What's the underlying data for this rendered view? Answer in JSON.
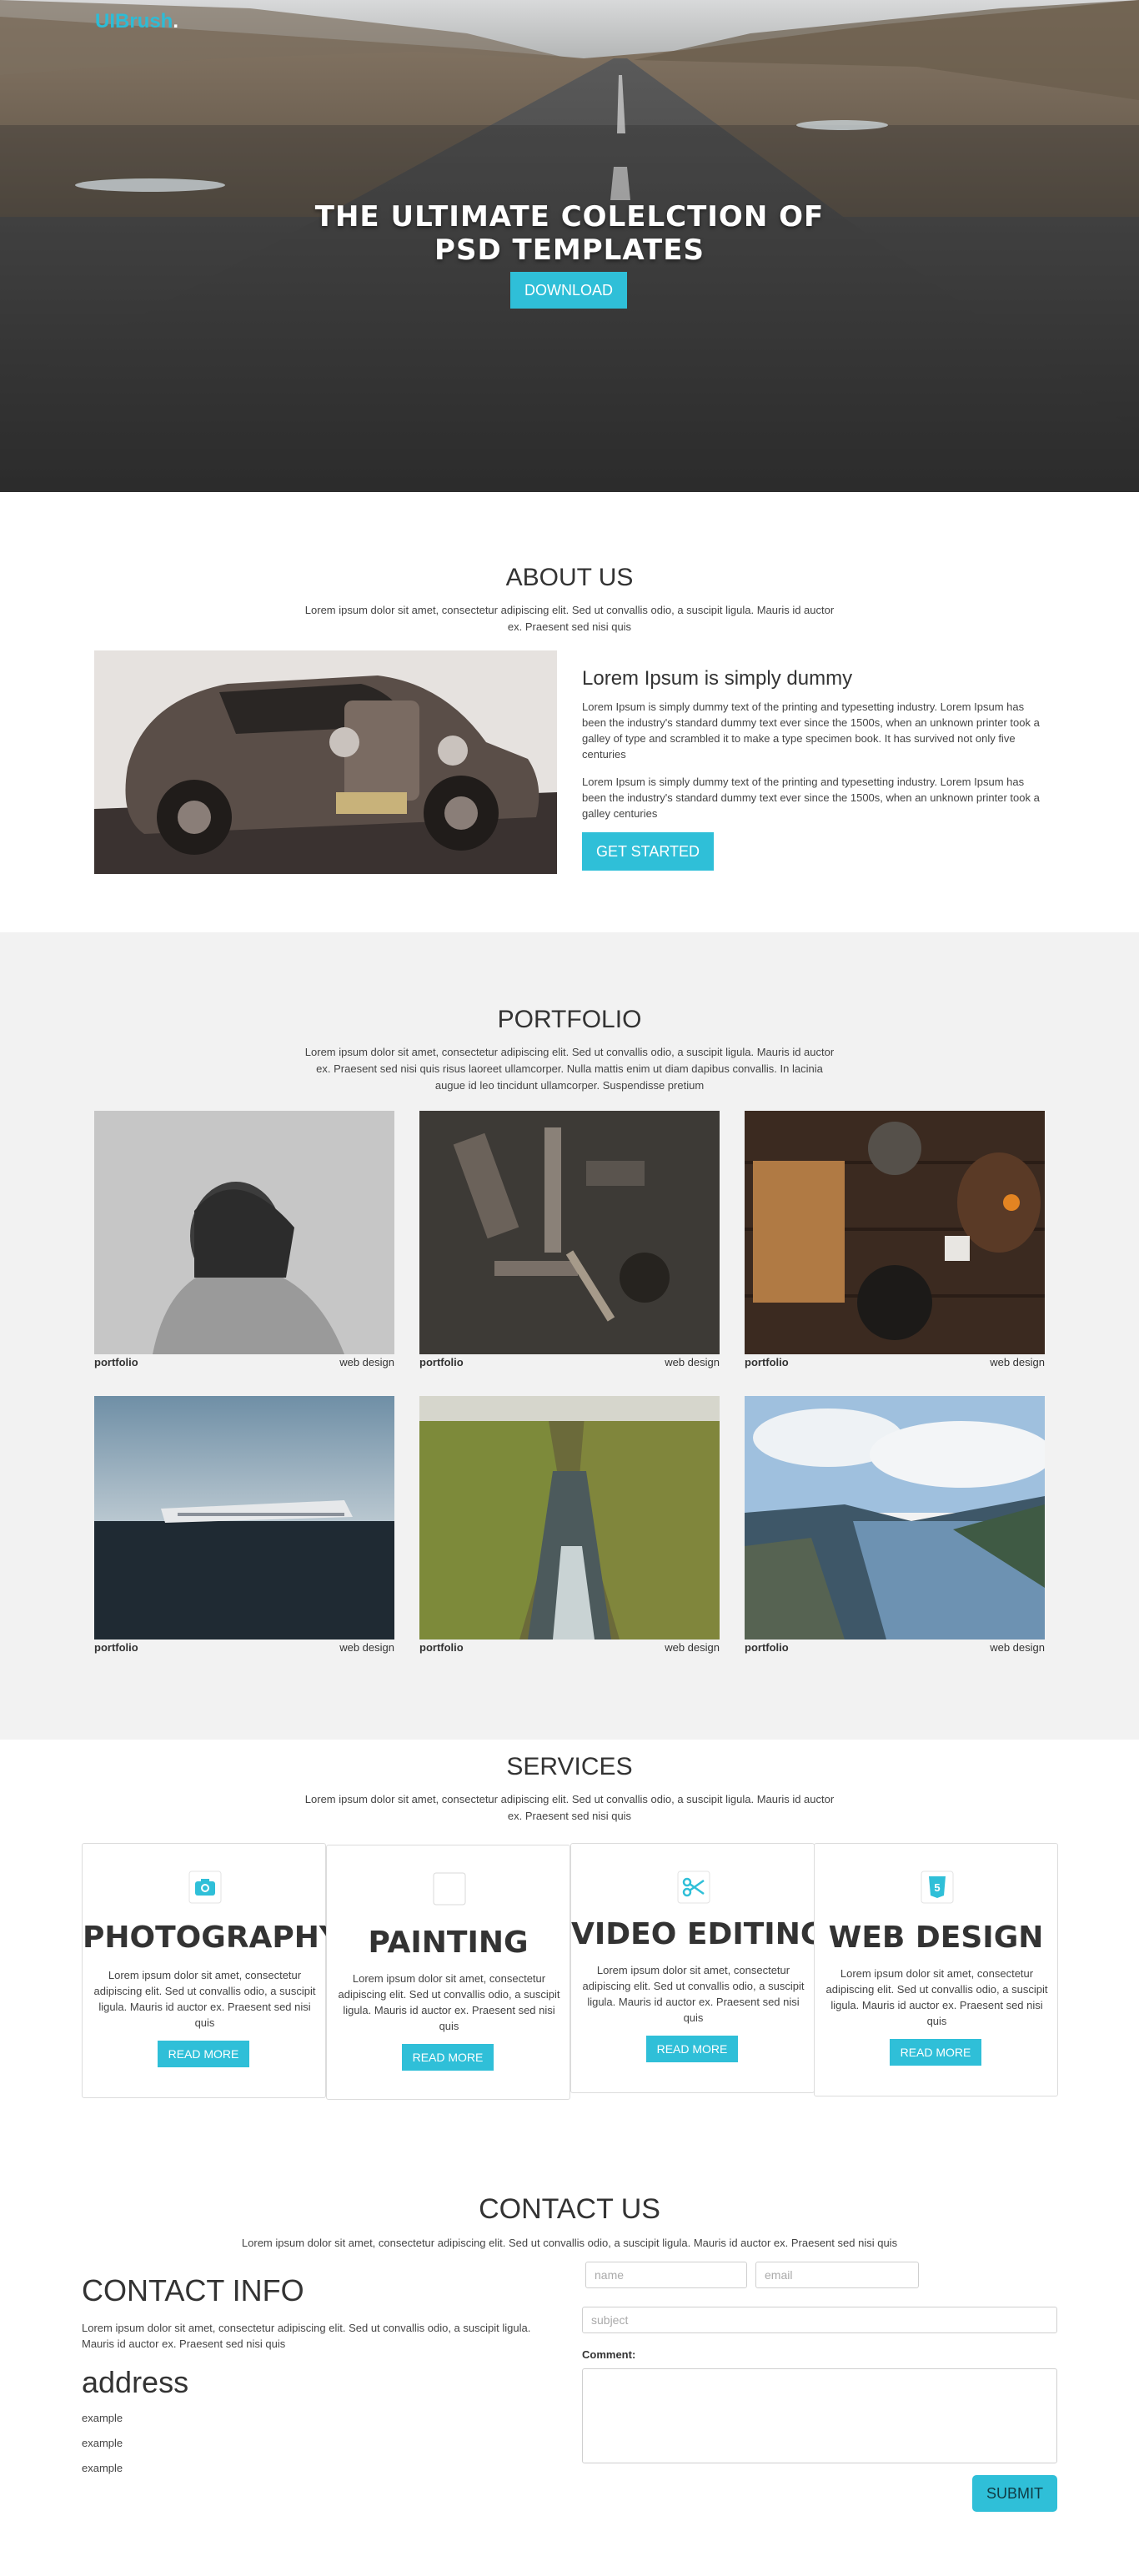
{
  "brand": {
    "logo_text": "UIBrush",
    "logo_dot": ".",
    "accent": "#2fbfd8"
  },
  "hero": {
    "title_line1": "THE ULTIMATE COLELCTION OF",
    "title_line2": "PSD TEMPLATES",
    "download_label": "DOWNLOAD"
  },
  "about": {
    "title": "ABOUT US",
    "subtitle": "Lorem ipsum dolor sit amet, consectetur adipiscing elit. Sed ut convallis odio, a suscipit ligula. Mauris id auctor ex. Praesent sed nisi quis",
    "heading": "Lorem Ipsum is simply dummy",
    "para1": "Lorem Ipsum is simply dummy text of the printing and typesetting industry. Lorem Ipsum has been the industry's standard dummy text ever since the 1500s, when an unknown printer took a galley of type and scrambled it to make a type specimen book. It has survived not only five centuries",
    "para2": "Lorem Ipsum is simply dummy text of the printing and typesetting industry. Lorem Ipsum has been the industry's standard dummy text ever since the 1500s, when an unknown printer took a galley centuries",
    "cta_label": "GET STARTED"
  },
  "portfolio": {
    "title": "PORTFOLIO",
    "subtitle": "Lorem ipsum dolor sit amet, consectetur adipiscing elit. Sed ut convallis odio, a suscipit ligula. Mauris id auctor ex. Praesent sed nisi quis risus laoreet ullamcorper. Nulla mattis enim ut diam dapibus convallis. In lacinia augue id leo tincidunt ullamcorper. Suspendisse pretium",
    "items": [
      {
        "label": "portfolio",
        "category": "web design"
      },
      {
        "label": "portfolio",
        "category": "web design"
      },
      {
        "label": "portfolio",
        "category": "web design"
      },
      {
        "label": "portfolio",
        "category": "web design"
      },
      {
        "label": "portfolio",
        "category": "web design"
      },
      {
        "label": "portfolio",
        "category": "web design"
      }
    ]
  },
  "services": {
    "title": "SERVICES",
    "subtitle": "Lorem ipsum dolor sit amet, consectetur adipiscing elit. Sed ut convallis odio, a suscipit ligula. Mauris id auctor ex. Praesent sed nisi quis",
    "items": [
      {
        "title": "PHOTOGRAPHY",
        "icon": "camera-icon",
        "text": "Lorem ipsum dolor sit amet, consectetur adipiscing elit. Sed ut convallis odio, a suscipit ligula. Mauris id auctor ex. Praesent sed nisi quis",
        "button": "READ MORE"
      },
      {
        "title": "PAINTING",
        "icon": "painting-icon",
        "text": "Lorem ipsum dolor sit amet, consectetur adipiscing elit. Sed ut convallis odio, a suscipit ligula. Mauris id auctor ex. Praesent sed nisi quis",
        "button": "READ MORE"
      },
      {
        "title": "VIDEO EDITING",
        "icon": "scissors-icon",
        "text": "Lorem ipsum dolor sit amet, consectetur adipiscing elit. Sed ut convallis odio, a suscipit ligula. Mauris id auctor ex. Praesent sed nisi quis",
        "button": "READ MORE"
      },
      {
        "title": "WEB DESIGN",
        "icon": "html5-icon",
        "text": "Lorem ipsum dolor sit amet, consectetur adipiscing elit. Sed ut convallis odio, a suscipit ligula. Mauris id auctor ex. Praesent sed nisi quis",
        "button": "READ MORE"
      }
    ]
  },
  "contact": {
    "title": "CONTACT US",
    "subtitle": "Lorem ipsum dolor sit amet, consectetur adipiscing elit. Sed ut convallis odio, a suscipit ligula. Mauris id auctor ex. Praesent sed nisi quis",
    "info_title": "CONTACT INFO",
    "info_text": "Lorem ipsum dolor sit amet, consectetur adipiscing elit. Sed ut convallis odio, a suscipit ligula. Mauris id auctor ex. Praesent sed nisi quis",
    "address_title": "address",
    "address_lines": [
      "example",
      "example",
      "example"
    ],
    "name_placeholder": "name",
    "email_placeholder": "email",
    "subject_placeholder": "subject",
    "comment_label": "Comment:",
    "submit_label": "SUBMIT"
  }
}
